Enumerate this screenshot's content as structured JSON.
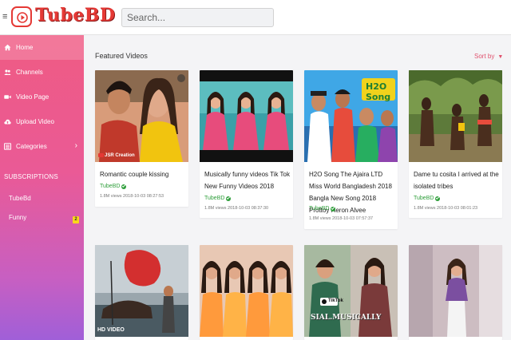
{
  "app": {
    "name": "TubeBD"
  },
  "search": {
    "placeholder": "Search..."
  },
  "sidebar": {
    "items": [
      {
        "label": "Home",
        "icon": "home-icon",
        "active": true
      },
      {
        "label": "Channels",
        "icon": "users-icon"
      },
      {
        "label": "Video Page",
        "icon": "video-camera-icon"
      },
      {
        "label": "Upload Video",
        "icon": "cloud-upload-icon"
      },
      {
        "label": "Categories",
        "icon": "list-icon",
        "has_children": true
      }
    ],
    "subscriptions_title": "SUBSCRIPTIONS",
    "subscriptions": [
      {
        "label": "TubeBd"
      },
      {
        "label": "Funny",
        "badge": "2"
      }
    ]
  },
  "main": {
    "section_title": "Featured Videos",
    "sort_label": "Sort by",
    "videos": [
      {
        "title": "Romantic couple kissing",
        "channel": "TubeBD",
        "meta": "1.8M views  2018-10-03 08:27:53",
        "thumb_caption": "JSR Creation"
      },
      {
        "title": "Musically funny videos Tik Tok New Funny Videos 2018",
        "channel": "TubeBD",
        "meta": "1.8M views  2018-10-03 08:37:30"
      },
      {
        "title": "H2O Song The Ajaira LTD Miss World Bangladesh 2018 Bangla New Song 2018 Prottoy Heron Alvee",
        "channel": "TubeBD",
        "meta": "1.8M views  2018-10-03 07:57:37",
        "thumb_caption": "H2O Song"
      },
      {
        "title": "Dame tu cosita I arrived at the isolated tribes",
        "channel": "TubeBD",
        "meta": "1.8M views  2018-10-03 08:01:23"
      },
      {
        "title": "",
        "thumb_caption": "HD VIDEO"
      },
      {
        "title": ""
      },
      {
        "title": "",
        "thumb_caption": "SIAL.MUSICALLY",
        "thumb_caption_2": "TikTok"
      },
      {
        "title": ""
      }
    ]
  },
  "colors": {
    "brand": "#e53935",
    "accent": "#e0516d",
    "verified": "#2e9e3a",
    "badge": "#f9d71c"
  }
}
